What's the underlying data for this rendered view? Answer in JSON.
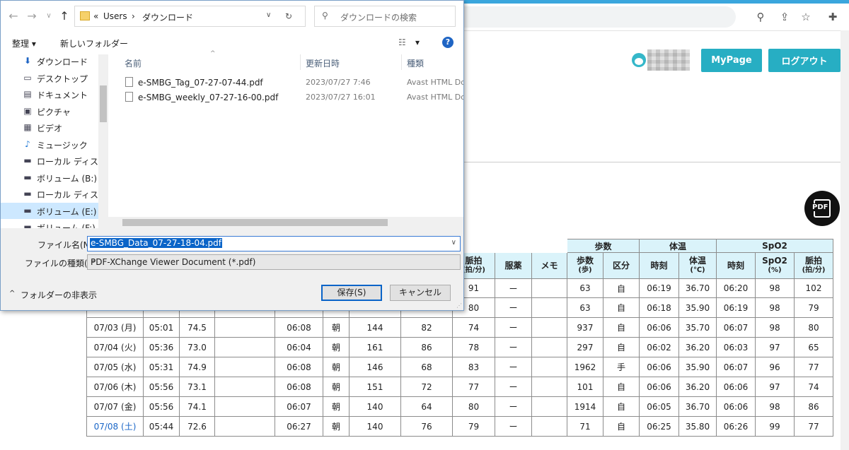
{
  "browser": {
    "icons": [
      "zoom-icon",
      "share-icon",
      "star-icon",
      "extensions-icon"
    ]
  },
  "page": {
    "mypage_label": "MyPage",
    "logout_label": "ログアウト",
    "pdf_label": "PDF"
  },
  "table": {
    "group_headers": [
      "歩数",
      "体温",
      "SpO2"
    ],
    "sub_headers": {
      "pulse": [
        "脈拍",
        "(拍/分)"
      ],
      "medication": "服薬",
      "memo": "メモ",
      "steps": [
        "歩数",
        "(歩)"
      ],
      "category": "区分",
      "temp_time": "時刻",
      "temp": [
        "体温",
        "(℃)"
      ],
      "spo2_time": "時刻",
      "spo2": [
        "SpO2",
        "(%)"
      ],
      "spo2_pulse": [
        "脈拍",
        "(拍/分)"
      ]
    },
    "rows": [
      {
        "date": "",
        "t1": "",
        "weight": "",
        "note": "",
        "t2": "",
        "meal": "",
        "bs": "",
        "pulse1": "",
        "pulse2": "91",
        "med": "ー",
        "memo": "",
        "steps": "63",
        "cat": "自",
        "tt": "06:19",
        "temp": "36.70",
        "st": "06:20",
        "spo2": "98",
        "sp": "102"
      },
      {
        "date": "",
        "t1": "",
        "weight": "",
        "note": "",
        "t2": "",
        "meal": "",
        "bs": "",
        "pulse1": "",
        "pulse2": "80",
        "med": "ー",
        "memo": "",
        "steps": "63",
        "cat": "自",
        "tt": "06:18",
        "temp": "35.90",
        "st": "06:19",
        "spo2": "98",
        "sp": "79"
      },
      {
        "date": "07/03 (月)",
        "t1": "05:01",
        "weight": "74.5",
        "note": "",
        "t2": "06:08",
        "meal": "朝",
        "bs": "144",
        "pulse1": "82",
        "pulse2": "74",
        "med": "ー",
        "memo": "",
        "steps": "937",
        "cat": "自",
        "tt": "06:06",
        "temp": "35.70",
        "st": "06:07",
        "spo2": "98",
        "sp": "80"
      },
      {
        "date": "07/04 (火)",
        "t1": "05:36",
        "weight": "73.0",
        "note": "",
        "t2": "06:04",
        "meal": "朝",
        "bs": "161",
        "pulse1": "86",
        "pulse2": "78",
        "med": "ー",
        "memo": "",
        "steps": "297",
        "cat": "自",
        "tt": "06:02",
        "temp": "36.20",
        "st": "06:03",
        "spo2": "97",
        "sp": "65"
      },
      {
        "date": "07/05 (水)",
        "t1": "05:31",
        "weight": "74.9",
        "note": "",
        "t2": "06:08",
        "meal": "朝",
        "bs": "146",
        "pulse1": "68",
        "pulse2": "83",
        "med": "ー",
        "memo": "",
        "steps": "1962",
        "cat": "手",
        "tt": "06:06",
        "temp": "35.90",
        "st": "06:07",
        "spo2": "96",
        "sp": "77"
      },
      {
        "date": "07/06 (木)",
        "t1": "05:56",
        "weight": "73.1",
        "note": "",
        "t2": "06:08",
        "meal": "朝",
        "bs": "151",
        "pulse1": "72",
        "pulse2": "77",
        "med": "ー",
        "memo": "",
        "steps": "101",
        "cat": "自",
        "tt": "06:06",
        "temp": "36.20",
        "st": "06:06",
        "spo2": "97",
        "sp": "74"
      },
      {
        "date": "07/07 (金)",
        "t1": "05:56",
        "weight": "74.1",
        "note": "",
        "t2": "06:07",
        "meal": "朝",
        "bs": "140",
        "pulse1": "64",
        "pulse2": "80",
        "med": "ー",
        "memo": "",
        "steps": "1914",
        "cat": "自",
        "tt": "06:05",
        "temp": "36.70",
        "st": "06:06",
        "spo2": "98",
        "sp": "86"
      },
      {
        "date": "07/08 (土)",
        "t1": "05:44",
        "weight": "72.6",
        "note": "",
        "t2": "06:27",
        "meal": "朝",
        "bs": "140",
        "pulse1": "76",
        "pulse2": "79",
        "med": "ー",
        "memo": "",
        "steps": "71",
        "cat": "自",
        "tt": "06:25",
        "temp": "35.80",
        "st": "06:26",
        "spo2": "99",
        "sp": "77",
        "saturday": true
      }
    ]
  },
  "dialog": {
    "path": {
      "prefix": "«",
      "part1": "Users",
      "sep": "›",
      "part2": "ダウンロード"
    },
    "search_placeholder": "ダウンロードの検索",
    "toolbar": {
      "organize": "整理 ▾",
      "new_folder": "新しいフォルダー",
      "view": "▾"
    },
    "tree": [
      {
        "icon": "download-icon",
        "glyph": "⬇",
        "label": "ダウンロード"
      },
      {
        "icon": "desktop-icon",
        "glyph": "▭",
        "label": "デスクトップ"
      },
      {
        "icon": "documents-icon",
        "glyph": "▤",
        "label": "ドキュメント"
      },
      {
        "icon": "pictures-icon",
        "glyph": "▣",
        "label": "ピクチャ"
      },
      {
        "icon": "videos-icon",
        "glyph": "▦",
        "label": "ビデオ"
      },
      {
        "icon": "music-icon",
        "glyph": "♪",
        "label": "ミュージック"
      },
      {
        "icon": "drive-icon",
        "glyph": "▬",
        "label": "ローカル ディスク (A"
      },
      {
        "icon": "drive-icon",
        "glyph": "▬",
        "label": "ボリューム (B:)"
      },
      {
        "icon": "drive-icon",
        "glyph": "▬",
        "label": "ローカル ディスク (C"
      },
      {
        "icon": "drive-icon",
        "glyph": "▬",
        "label": "ボリューム (E:)",
        "selected": true
      },
      {
        "icon": "drive-icon",
        "glyph": "▬",
        "label": "ボリューム (F:)"
      }
    ],
    "columns": {
      "name": "名前",
      "date": "更新日時",
      "type": "種類"
    },
    "files": [
      {
        "name": "e-SMBG_Tag_07-27-07-44.pdf",
        "date": "2023/07/27 7:46",
        "type": "Avast HTML Do"
      },
      {
        "name": "e-SMBG_weekly_07-27-16-00.pdf",
        "date": "2023/07/27 16:01",
        "type": "Avast HTML Do"
      }
    ],
    "filename_label": "ファイル名(N):",
    "filename_value": "e-SMBG_Data_07-27-18-04.pdf",
    "filetype_label": "ファイルの種類(T):",
    "filetype_value": "PDF-XChange Viewer Document (*.pdf)",
    "hide_folders": "フォルダーの非表示",
    "save_label": "保存(S)",
    "cancel_label": "キャンセル"
  }
}
